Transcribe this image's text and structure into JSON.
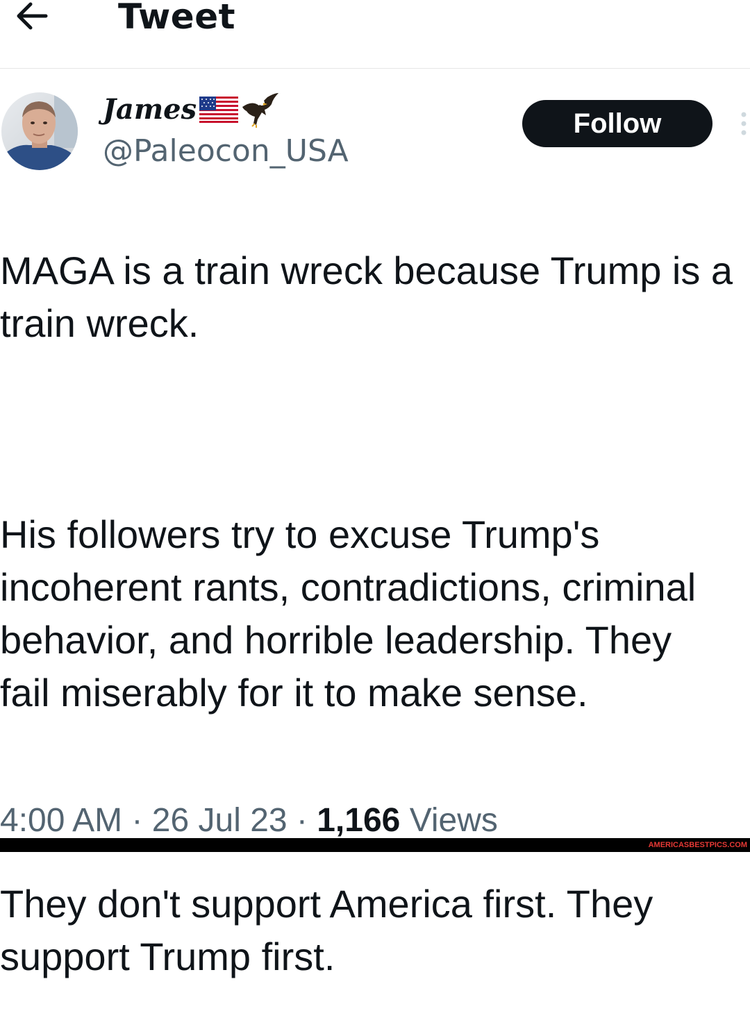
{
  "header": {
    "title": "Tweet",
    "back_icon": "arrow-left-icon"
  },
  "author": {
    "display_name": "James",
    "display_name_emojis": [
      "us-flag-icon",
      "eagle-icon"
    ],
    "handle": "@Paleocon_USA",
    "avatar": "profile-photo"
  },
  "actions": {
    "follow_label": "Follow",
    "more_icon": "more-vertical-icon"
  },
  "tweet": {
    "paragraph_1": "MAGA is a train wreck because Trump is a train wreck.",
    "paragraph_2": "His followers try to excuse Trump's incoherent rants, contradictions, criminal behavior, and horrible leadership. They fail miserably for it to make sense.",
    "paragraph_3": "They don't support America first. They support Trump first."
  },
  "meta": {
    "time": "4:00 AM",
    "separator": " · ",
    "date": "26 Jul 23",
    "views_count": "1,166",
    "views_label": "Views"
  },
  "watermark": {
    "text": "AMERICASBESTPICS.COM"
  },
  "colors": {
    "text_primary": "#0f1419",
    "text_secondary": "#536471",
    "button_bg": "#0f1419",
    "button_text": "#ffffff",
    "watermark_red": "#e53935"
  }
}
